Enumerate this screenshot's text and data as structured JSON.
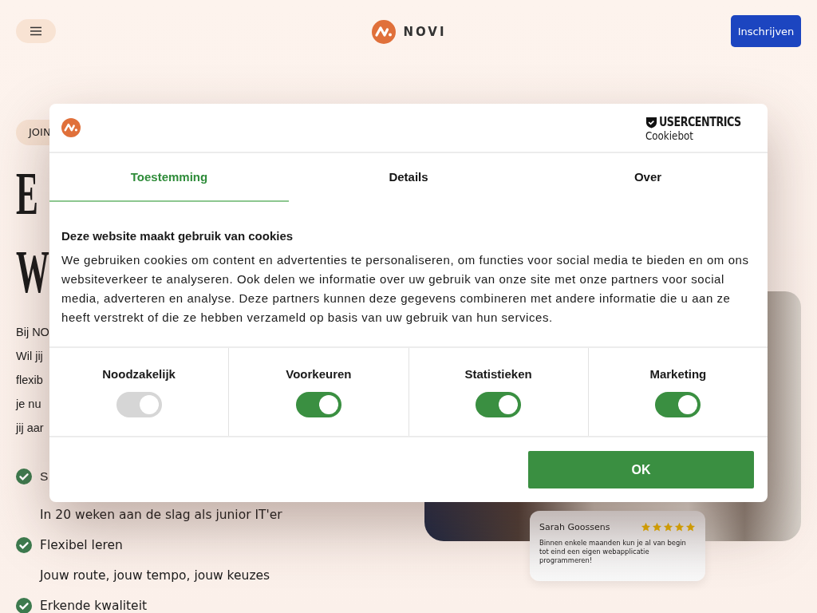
{
  "header": {
    "logo_text": "NOVI",
    "signup_button": "Inschrijven"
  },
  "hero": {
    "badge": "JOIN",
    "heading_lines": [
      "E",
      "W"
    ],
    "intro_lines": [
      "Bij NO",
      "Wil jij",
      "flexib",
      "je nu",
      "jij aar"
    ],
    "benefits": [
      {
        "title": "S",
        "subtitle": "In 20 weken aan de slag als junior IT'er"
      },
      {
        "title": "Flexibel leren",
        "subtitle": "Jouw route, jouw tempo, jouw keuzes"
      },
      {
        "title": "Erkende kwaliteit"
      }
    ]
  },
  "review": {
    "name": "Sarah Goossens",
    "stars": 5,
    "text": "Binnen enkele maanden kun je al van begin tot eind een eigen webapplicatie programmeren!"
  },
  "cookie_dialog": {
    "brand": "USERCENTRICS",
    "brand_sub": "Cookiebot",
    "tabs": [
      {
        "label": "Toestemming",
        "selected": true
      },
      {
        "label": "Details",
        "selected": false
      },
      {
        "label": "Over",
        "selected": false
      }
    ],
    "title": "Deze website maakt gebruik van cookies",
    "body": "We gebruiken cookies om content en advertenties te personaliseren, om functies voor social media te bieden en om ons websiteverkeer te analyseren. Ook delen we informatie over uw gebruik van onze site met onze partners voor social media, adverteren en analyse. Deze partners kunnen deze gegevens combineren met andere informatie die u aan ze heeft verstrekt of die ze hebben verzameld op basis van uw gebruik van hun services.",
    "categories": [
      {
        "label": "Noodzakelijk",
        "checked": true,
        "disabled": true
      },
      {
        "label": "Voorkeuren",
        "checked": true,
        "disabled": false
      },
      {
        "label": "Statistieken",
        "checked": true,
        "disabled": false
      },
      {
        "label": "Marketing",
        "checked": true,
        "disabled": false
      }
    ],
    "ok_button": "OK"
  }
}
